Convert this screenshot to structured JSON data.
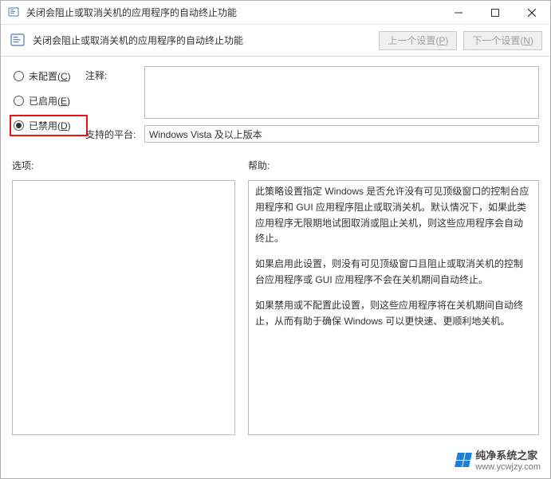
{
  "titlebar": {
    "title": "关闭会阻止或取消关机的应用程序的自动终止功能"
  },
  "header": {
    "title": "关闭会阻止或取消关机的应用程序的自动终止功能",
    "prev_label": "上一个设置(P)",
    "next_label": "下一个设置(N)"
  },
  "radio": {
    "not_configured": "未配置(C)",
    "enabled": "已启用(E)",
    "disabled": "已禁用(D)",
    "selected": "disabled"
  },
  "fields": {
    "comment_label": "注释:",
    "comment_value": "",
    "platform_label": "支持的平台:",
    "platform_value": "Windows Vista 及以上版本"
  },
  "sections": {
    "options_label": "选项:",
    "help_label": "帮助:"
  },
  "help": {
    "p1": "此策略设置指定 Windows 是否允许没有可见顶级窗口的控制台应用程序和 GUI 应用程序阻止或取消关机。默认情况下，如果此类应用程序无限期地试图取消或阻止关机，则这些应用程序会自动终止。",
    "p2": "如果启用此设置，则没有可见顶级窗口且阻止或取消关机的控制台应用程序或 GUI 应用程序不会在关机期间自动终止。",
    "p3": "如果禁用或不配置此设置，则这些应用程序将在关机期间自动终止，从而有助于确保 Windows 可以更快速、更顺利地关机。"
  },
  "watermark": {
    "brand": "纯净系统之家",
    "url": "www.ycwjzy.com"
  }
}
